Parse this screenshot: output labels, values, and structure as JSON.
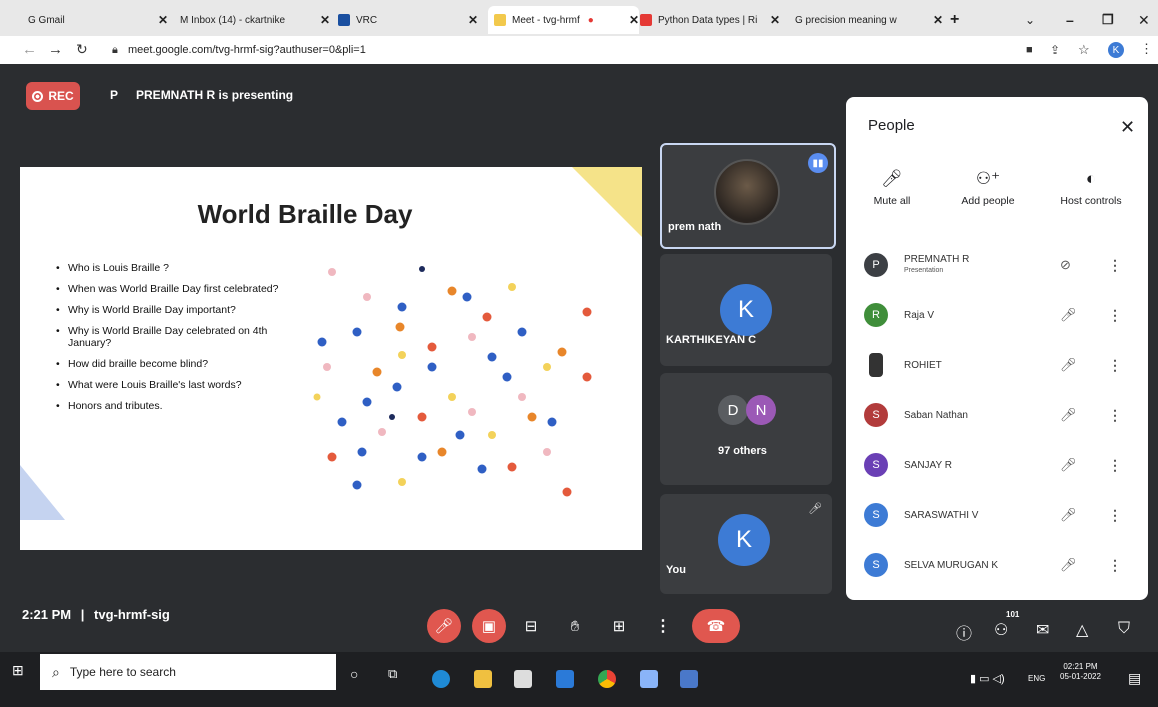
{
  "browser": {
    "tabs": [
      {
        "label": "G  Gmail",
        "color": "#ffffff",
        "active": false
      },
      {
        "label": "M  Inbox (14) - ckartnike",
        "color": "#d93025",
        "active": false
      },
      {
        "label": "VRC",
        "color": "#1a4fa0",
        "active": false
      },
      {
        "label": "Meet - tvg-hrmf",
        "color": "#f2c94c",
        "active": true
      },
      {
        "label": "Python Data types | Ri",
        "color": "#e53935",
        "active": false
      },
      {
        "label": "G  precision meaning w",
        "color": "#ffffff",
        "active": false
      }
    ],
    "new_tab": "+",
    "url": "meet.google.com/tvg-hrmf-sig?authuser=0&pli=1"
  },
  "meet": {
    "rec_label": "REC",
    "presenter_initial": "P",
    "presenting_text": "PREMNATH R is presenting",
    "clock": "2:21 PM",
    "divider": "|",
    "meeting_code": "tvg-hrmf-sig",
    "people_count": "101"
  },
  "slide": {
    "title": "World Braille Day",
    "bullets": [
      "Who is Louis Braille ?",
      "When was World Braille Day first celebrated?",
      "Why is World Braille Day important?",
      "Why is World Braille Day celebrated on 4th January?",
      "How did braille become blind?",
      "What were Louis Braille's last words?",
      "Honors and tributes."
    ]
  },
  "tiles": {
    "prem": {
      "name": "prem nath"
    },
    "karthi": {
      "initial": "K",
      "name": "KARTHIKEYAN C"
    },
    "others": {
      "initials": [
        "D",
        "N"
      ],
      "label": "97 others"
    },
    "you": {
      "initial": "K",
      "name": "You"
    }
  },
  "people": {
    "title": "People",
    "actions": [
      "Mute all",
      "Add people",
      "Host controls"
    ],
    "list": [
      {
        "initial": "P",
        "name": "PREMNATH R",
        "sub": "Presentation",
        "color": "#3c3f44"
      },
      {
        "initial": "R",
        "name": "Raja V",
        "sub": "",
        "color": "#3f8e3a"
      },
      {
        "initial": "",
        "name": "ROHIET",
        "sub": "",
        "color": "#333333"
      },
      {
        "initial": "S",
        "name": "Saban Nathan",
        "sub": "",
        "color": "#b23b3b"
      },
      {
        "initial": "S",
        "name": "SANJAY R",
        "sub": "",
        "color": "#6a3fb5"
      },
      {
        "initial": "S",
        "name": "SARASWATHI V",
        "sub": "",
        "color": "#3d7bd5"
      },
      {
        "initial": "S",
        "name": "SELVA MURUGAN K",
        "sub": "",
        "color": "#3d7bd5"
      }
    ]
  },
  "taskbar": {
    "search_placeholder": "Type here to search",
    "lang": "ENG",
    "time": "02:21 PM",
    "date": "05-01-2022"
  }
}
